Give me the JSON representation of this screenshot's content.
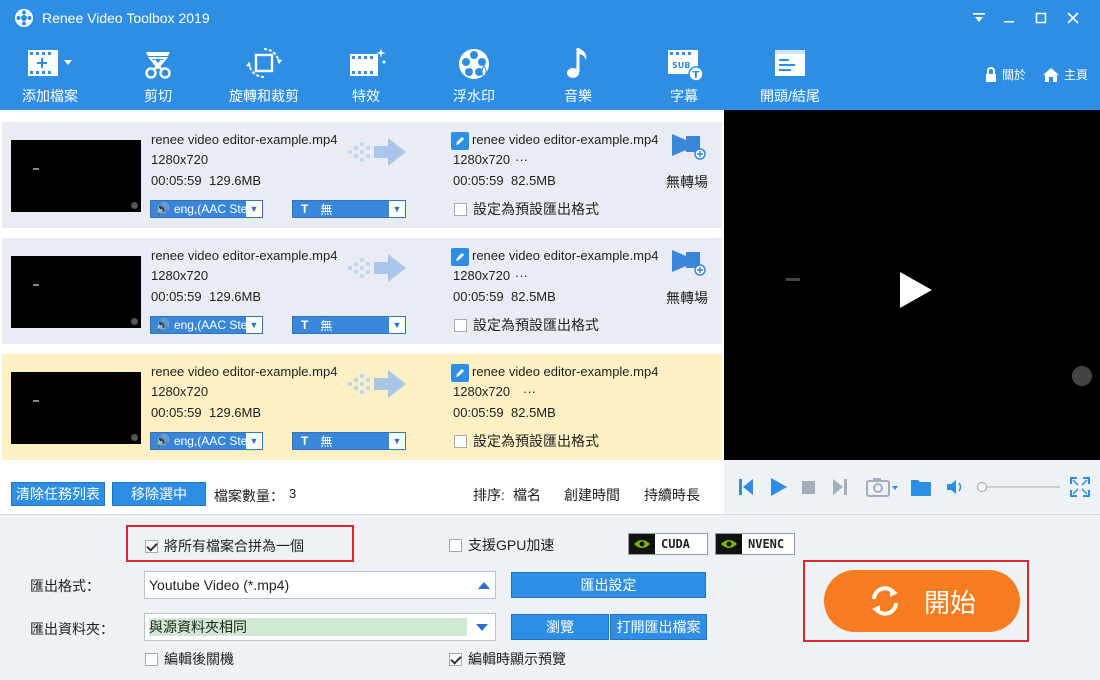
{
  "window": {
    "title": "Renee Video Toolbox 2019"
  },
  "toolbar": [
    {
      "label": "添加檔案",
      "icon": "add-file-icon"
    },
    {
      "label": "剪切",
      "icon": "scissors-icon"
    },
    {
      "label": "旋轉和裁剪",
      "icon": "rotate-crop-icon"
    },
    {
      "label": "特效",
      "icon": "film-effects-icon"
    },
    {
      "label": "浮水印",
      "icon": "watermark-icon"
    },
    {
      "label": "音樂",
      "icon": "music-note-icon"
    },
    {
      "label": "字幕",
      "icon": "subtitle-icon"
    },
    {
      "label": "開頭/結尾",
      "icon": "intro-outro-icon"
    }
  ],
  "header_links": {
    "about": "關於",
    "home": "主頁"
  },
  "files": [
    {
      "name": "renee video editor-example.mp4",
      "resolution": "1280x720",
      "duration": "00:05:59",
      "size": "129.6MB",
      "out_name": "renee video editor-example.mp4",
      "out_resolution": "1280x720",
      "out_more": "···",
      "out_duration": "00:05:59",
      "out_size": "82.5MB",
      "audio": "eng,(AAC Ste",
      "subtitle": "無",
      "transition": "無轉場",
      "default_fmt": "設定為預設匯出格式"
    },
    {
      "name": "renee video editor-example.mp4",
      "resolution": "1280x720",
      "duration": "00:05:59",
      "size": "129.6MB",
      "out_name": "renee video editor-example.mp4",
      "out_resolution": "1280x720",
      "out_more": "···",
      "out_duration": "00:05:59",
      "out_size": "82.5MB",
      "audio": "eng,(AAC Ste",
      "subtitle": "無",
      "transition": "無轉場",
      "default_fmt": "設定為預設匯出格式"
    },
    {
      "name": "renee video editor-example.mp4",
      "resolution": "1280x720",
      "duration": "00:05:59",
      "size": "129.6MB",
      "out_name": "renee video editor-example.mp4",
      "out_resolution": "1280x720",
      "out_more": "···",
      "out_duration": "00:05:59",
      "out_size": "82.5MB",
      "audio": "eng,(AAC Ste",
      "subtitle": "無",
      "default_fmt": "設定為預設匯出格式"
    }
  ],
  "list_actions": {
    "clear": "清除任務列表",
    "remove": "移除選中",
    "count_label": "檔案數量：",
    "count": "3",
    "sort_label": "排序:",
    "sort_name": "檔名",
    "sort_created": "創建時間",
    "sort_duration": "持續時長"
  },
  "player": {
    "volume": 0.05
  },
  "settings": {
    "merge_label": "將所有檔案合拼為一個",
    "merge_checked": true,
    "gpu_label": "支援GPU加速",
    "gpu_checked": false,
    "cuda": "CUDA",
    "nvenc": "NVENC",
    "format_label": "匯出格式：",
    "format_value": "Youtube Video (*.mp4)",
    "export_settings": "匯出設定",
    "folder_label": "匯出資料夾：",
    "folder_value": "與源資料夾相同",
    "browse": "瀏覽",
    "open_folder": "打開匯出檔案",
    "shutdown_label": "編輯後關機",
    "preview_label": "編輯時顯示預覽",
    "preview_checked": true
  },
  "start_button": "開始",
  "colors": {
    "brand_blue": "#2d8ee4",
    "start_orange": "#f57c1f",
    "highlight_red": "#e0232b",
    "selected_row": "#fdf0c4"
  }
}
